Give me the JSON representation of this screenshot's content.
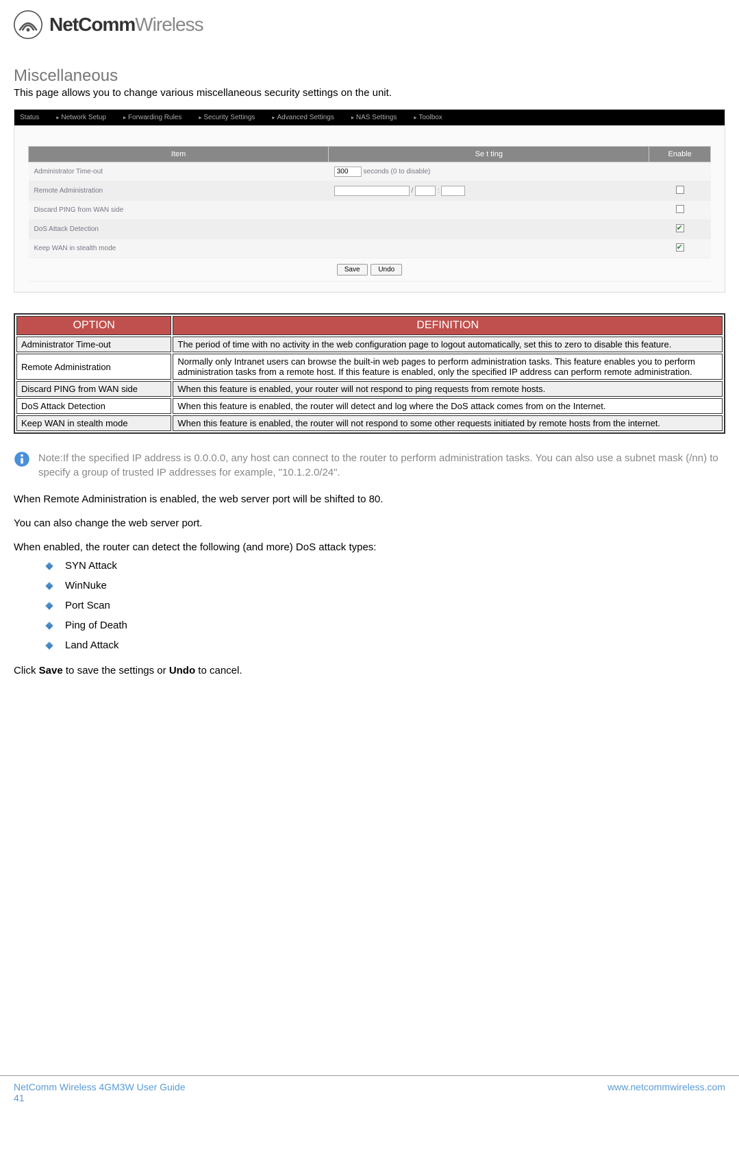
{
  "brand": {
    "name_bold": "NetComm",
    "name_light": "Wireless"
  },
  "page": {
    "title": "Miscellaneous",
    "intro": "This page allows you to change various miscellaneous security settings on the unit."
  },
  "router_nav": [
    "Status",
    "Network Setup",
    "Forwarding Rules",
    "Security Settings",
    "Advanced Settings",
    "NAS Settings",
    "Toolbox"
  ],
  "settings_headers": {
    "item": "Item",
    "setting": "Se t ting",
    "enable": "Enable"
  },
  "settings_rows": [
    {
      "label": "Administrator Time-out",
      "timeout_value": "300",
      "timeout_suffix": "seconds (0 to disable)"
    },
    {
      "label": "Remote Administration"
    },
    {
      "label": "Discard PING from WAN side"
    },
    {
      "label": "DoS Attack Detection"
    },
    {
      "label": "Keep WAN in stealth mode"
    }
  ],
  "buttons": {
    "save": "Save",
    "undo": "Undo"
  },
  "def_headers": {
    "option": "OPTION",
    "definition": "DEFINITION"
  },
  "def_rows": [
    {
      "option": "Administrator Time-out",
      "definition": "The period of time with no activity in the web configuration page to logout automatically, set this to zero to disable this feature."
    },
    {
      "option": "Remote Administration",
      "definition": "Normally only Intranet users can browse the built-in web pages to perform administration tasks. This feature enables you to perform administration tasks from a remote host. If this feature is enabled, only the specified IP address can perform remote administration."
    },
    {
      "option": "Discard PING from WAN side",
      "definition": "When this feature is enabled, your router will not respond to ping requests from remote hosts."
    },
    {
      "option": "DoS Attack Detection",
      "definition": "When this feature is enabled, the router will detect and log where the DoS attack comes from on the Internet."
    },
    {
      "option": "Keep WAN in stealth mode",
      "definition": "When this feature is enabled, the router will not respond to some other requests initiated by remote hosts from the internet."
    }
  ],
  "note": "Note:If the specified IP address is 0.0.0.0, any host can connect to the router to perform administration tasks. You can also use a subnet mask (/nn) to specify a group of trusted IP addresses for example, \"10.1.2.0/24\".",
  "paras": {
    "p1": "When Remote Administration is enabled, the web server port will be shifted to 80.",
    "p2": "You can also change the web server port.",
    "p3": "When enabled, the router can detect the following (and more) DoS attack types:"
  },
  "attacks": [
    "SYN Attack",
    "WinNuke",
    "Port Scan",
    "Ping of Death",
    "Land Attack"
  ],
  "save_text": {
    "pre": "Click ",
    "b1": "Save",
    "mid": " to save the settings or ",
    "b2": "Undo",
    "post": " to cancel."
  },
  "footer": {
    "guide": "NetComm Wireless 4GM3W User Guide",
    "url": "www.netcommwireless.com",
    "page": "41"
  }
}
